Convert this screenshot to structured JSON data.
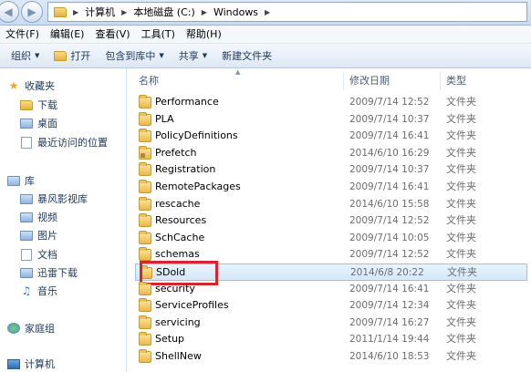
{
  "address": {
    "crumbs": [
      "计算机",
      "本地磁盘 (C:)",
      "Windows"
    ]
  },
  "menu": [
    "文件(F)",
    "编辑(E)",
    "查看(V)",
    "工具(T)",
    "帮助(H)"
  ],
  "toolbar": {
    "organize": "组织",
    "open": "打开",
    "include": "包含到库中",
    "share": "共享",
    "new_folder": "新建文件夹"
  },
  "nav": {
    "favorites": "收藏夹",
    "downloads": "下载",
    "desktop": "桌面",
    "recent": "最近访问的位置",
    "libraries": "库",
    "storm": "暴风影视库",
    "videos": "视频",
    "pictures": "图片",
    "documents": "文档",
    "xunlei": "迅雷下载",
    "music": "音乐",
    "homegroup": "家庭组",
    "computer": "计算机"
  },
  "columns": {
    "name": "名称",
    "modified": "修改日期",
    "type": "类型"
  },
  "files": [
    {
      "name": "Performance",
      "date": "2009/7/14 12:52",
      "type": "文件夹"
    },
    {
      "name": "PLA",
      "date": "2009/7/14 10:37",
      "type": "文件夹"
    },
    {
      "name": "PolicyDefinitions",
      "date": "2009/7/14 16:41",
      "type": "文件夹"
    },
    {
      "name": "Prefetch",
      "date": "2014/6/10 16:29",
      "type": "文件夹"
    },
    {
      "name": "Registration",
      "date": "2009/7/14 10:37",
      "type": "文件夹"
    },
    {
      "name": "RemotePackages",
      "date": "2009/7/14 16:41",
      "type": "文件夹"
    },
    {
      "name": "rescache",
      "date": "2014/6/10 15:58",
      "type": "文件夹"
    },
    {
      "name": "Resources",
      "date": "2009/7/14 12:52",
      "type": "文件夹"
    },
    {
      "name": "SchCache",
      "date": "2009/7/14 10:05",
      "type": "文件夹"
    },
    {
      "name": "schemas",
      "date": "2009/7/14 12:52",
      "type": "文件夹"
    },
    {
      "name": "SDold",
      "date": "2014/6/8 20:22",
      "type": "文件夹"
    },
    {
      "name": "security",
      "date": "2009/7/14 16:41",
      "type": "文件夹"
    },
    {
      "name": "ServiceProfiles",
      "date": "2009/7/14 12:34",
      "type": "文件夹"
    },
    {
      "name": "servicing",
      "date": "2009/7/14 16:27",
      "type": "文件夹"
    },
    {
      "name": "Setup",
      "date": "2011/1/14 19:44",
      "type": "文件夹"
    },
    {
      "name": "ShellNew",
      "date": "2014/6/10 18:53",
      "type": "文件夹"
    }
  ],
  "colors": {
    "highlight": "#d4262c",
    "selection": "#d5e7fb"
  }
}
